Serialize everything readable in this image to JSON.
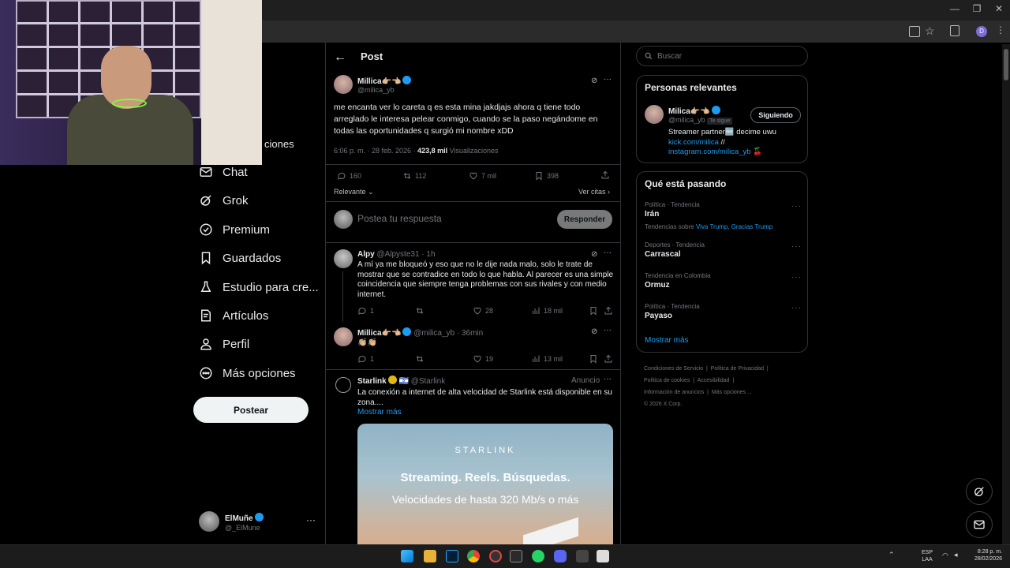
{
  "colors": {
    "accent": "#1d9bf0",
    "background": "#000000",
    "border": "#2f3336",
    "muted": "#71767b"
  },
  "nav": {
    "partial_item": "ciones",
    "items": [
      {
        "label": "Chat",
        "icon": "chat-icon"
      },
      {
        "label": "Grok",
        "icon": "grok-icon"
      },
      {
        "label": "Premium",
        "icon": "premium-icon"
      },
      {
        "label": "Guardados",
        "icon": "bookmark-icon"
      },
      {
        "label": "Estudio para cre...",
        "icon": "studio-icon"
      },
      {
        "label": "Artículos",
        "icon": "articles-icon"
      },
      {
        "label": "Perfil",
        "icon": "profile-icon"
      },
      {
        "label": "Más opciones",
        "icon": "more-options-icon"
      }
    ],
    "post_button": "Postear",
    "user": {
      "name": "ElMuñe",
      "handle": "@_ElMune"
    }
  },
  "header": {
    "title": "Post"
  },
  "post": {
    "author": "Millica👉🏼👈🏼",
    "handle": "@milica_yb",
    "text": "me encanta ver lo careta q es esta mina jakdjajs ahora q tiene todo arreglado le interesa pelear conmigo, cuando se la paso negándome en todas las oportunidades q surgió mi nombre xDD",
    "time": "6:06 p. m. · 28 feb. 2026 ·",
    "views": "423,8 mil",
    "views_label": "Visualizaciones",
    "replies": "160",
    "reposts": "112",
    "likes": "7 mil",
    "bookmarks": "398",
    "sort_label": "Relevante",
    "quotes_label": "Ver citas"
  },
  "compose": {
    "placeholder": "Postea tu respuesta",
    "button": "Responder"
  },
  "replies": [
    {
      "name": "Alpy",
      "handle": "@Alpyste31 · 1h",
      "text": "A mí ya me bloqueó y eso que no le dije nada malo, solo le trate de mostrar que se contradice en todo lo que habla. Al parecer es una simple coincidencia que siempre tenga problemas con sus rivales y con medio internet.",
      "replies": "1",
      "reposts": "",
      "likes": "28",
      "views": "18 mil"
    },
    {
      "name": "Millica👉🏼👈🏼",
      "handle": "@milica_yb · 36min",
      "text": "👏🏼👏🏼",
      "replies": "1",
      "reposts": "",
      "likes": "19",
      "views": "13 mil"
    }
  ],
  "ad": {
    "name": "Starlink",
    "flag": "🇮🇱",
    "handle": "@Starlink",
    "label": "Anuncio",
    "text": "La conexión a internet de alta velocidad de Starlink está disponible en su zona....",
    "more": "Mostrar más",
    "brand": "STARLINK",
    "headline": "Streaming. Reels. Búsquedas.",
    "subhead": "Velocidades de hasta 320 Mb/s o más"
  },
  "search": {
    "placeholder": "Buscar"
  },
  "relevant": {
    "title": "Personas relevantes",
    "name": "Milica👉🏼👈🏼",
    "handle": "@milica_yb",
    "follows_you": "Te sigue",
    "button": "Siguiendo",
    "bio_line1": "Streamer partner🆓 decime uwu",
    "link1": "kick.com/milica",
    "sep": "//",
    "link2": "instagram.com/milica_yb",
    "emoji": "🍒"
  },
  "trending": {
    "title": "Qué está pasando",
    "items": [
      {
        "category": "Política · Tendencia",
        "name": "Irán",
        "extra_prefix": "Tendencias sobre",
        "extra_links": "Viva Trump, Gracias Trump"
      },
      {
        "category": "Deportes · Tendencia",
        "name": "Carrascal"
      },
      {
        "category": "Tendencia en Colombia",
        "name": "Ormuz"
      },
      {
        "category": "Política · Tendencia",
        "name": "Payaso"
      }
    ],
    "more": "Mostrar más"
  },
  "footer": {
    "line1": [
      "Condiciones de Servicio",
      "Política de Privacidad"
    ],
    "line2": [
      "Política de cookies",
      "Accesibilidad"
    ],
    "line3": [
      "Información de anuncios",
      "Más opciones ..."
    ],
    "copyright": "© 2026 X Corp."
  },
  "taskbar": {
    "lang1": "ESP",
    "lang2": "LAA",
    "time": "8:28 p. m.",
    "date": "28/02/2026"
  }
}
